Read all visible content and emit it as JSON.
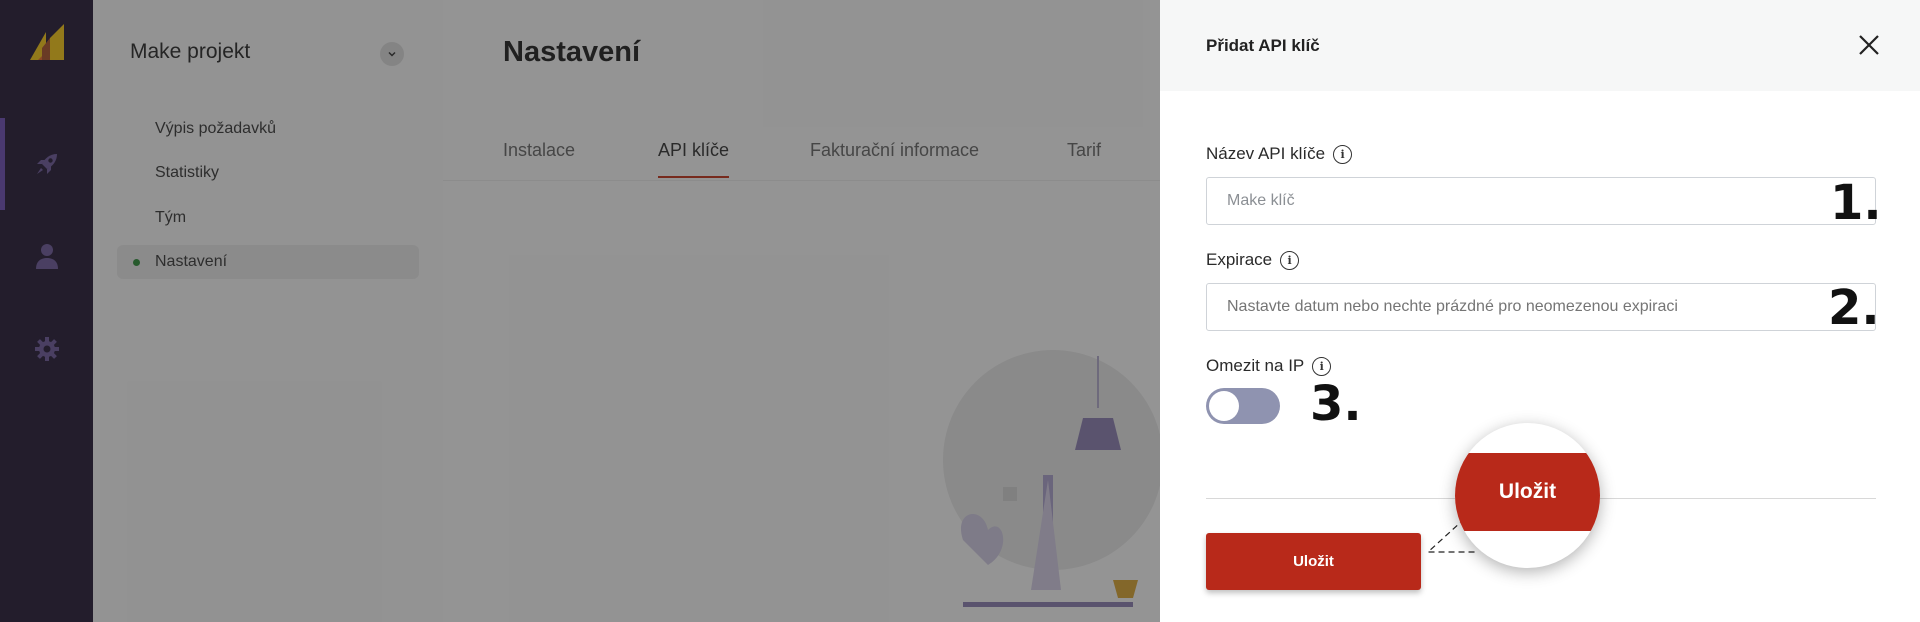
{
  "sidebar": {
    "project_name": "Make projekt",
    "items": [
      {
        "label": "Výpis požadavků"
      },
      {
        "label": "Statistiky"
      },
      {
        "label": "Tým"
      },
      {
        "label": "Nastavení"
      }
    ]
  },
  "main": {
    "title": "Nastavení",
    "tabs": [
      {
        "label": "Instalace"
      },
      {
        "label": "API klíče"
      },
      {
        "label": "Fakturační informace"
      },
      {
        "label": "Tarif"
      }
    ]
  },
  "drawer": {
    "title": "Přidat API klíč",
    "name_field": {
      "label": "Název API klíče",
      "value": "Make klíč",
      "marker": "1."
    },
    "expiry_field": {
      "label": "Expirace",
      "placeholder": "Nastavte datum nebo nechte prázdné pro neomezenou expiraci",
      "marker": "2."
    },
    "ip_limit": {
      "label": "Omezit na IP",
      "enabled": false,
      "marker": "3."
    },
    "save_label": "Uložit",
    "zoom_label": "Uložit"
  },
  "colors": {
    "rail": "#271c37",
    "accent": "#6d4fb3",
    "primary_button": "#b8291a",
    "toggle_off": "#8f93b0"
  },
  "icons": {
    "logo": "make-logo-icon",
    "rail": [
      "rocket-icon",
      "user-icon",
      "gear-icon"
    ],
    "close": "close-icon",
    "info": "info-icon"
  }
}
